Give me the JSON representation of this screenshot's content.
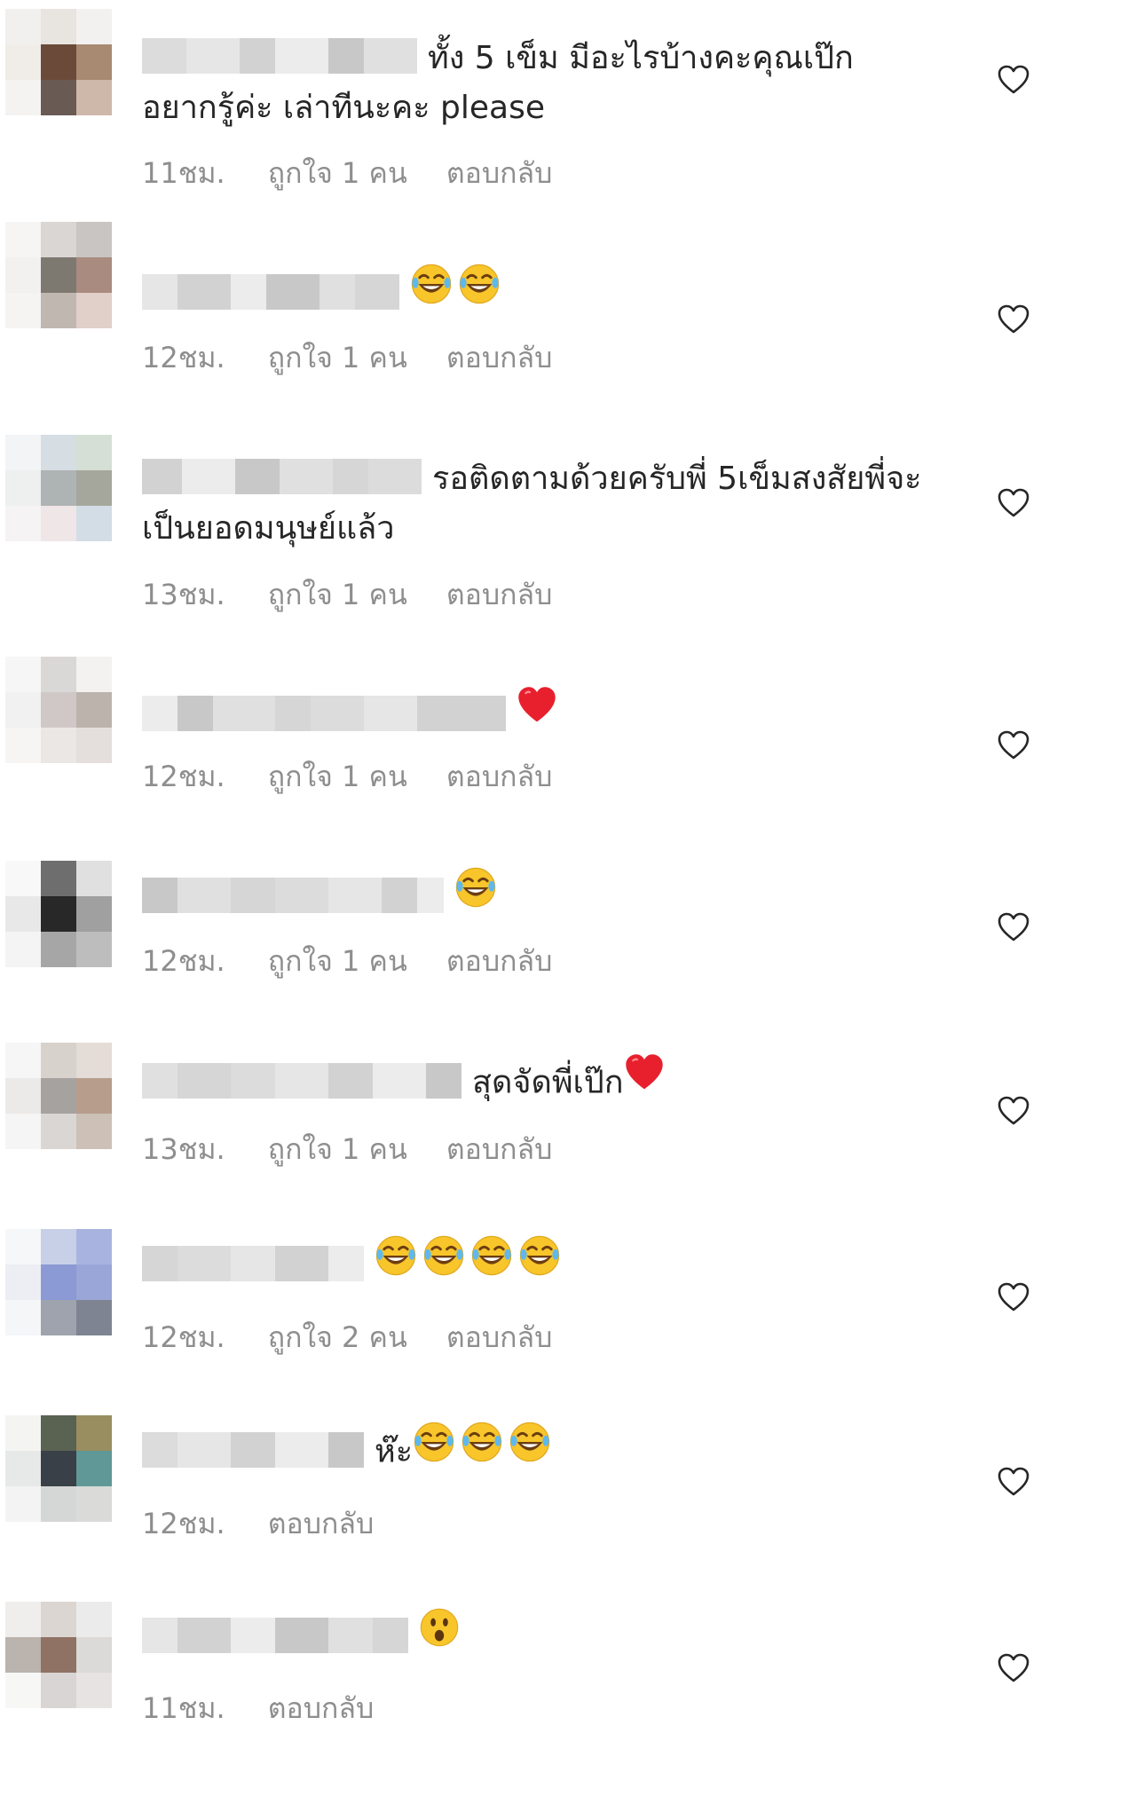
{
  "comments": [
    {
      "text_lines": [
        "ทั้ง 5 เข็ม มีอะไรบ้างคะคุณเป๊ก",
        "อยากรู้ค่ะ เล่าทีนะคะ please"
      ],
      "emojis": [],
      "time": "11ชม.",
      "likes": "ถูกใจ 1 คน",
      "reply": "ตอบกลับ"
    },
    {
      "text_lines": [
        ""
      ],
      "emojis": [
        "laugh",
        "laugh"
      ],
      "time": "12ชม.",
      "likes": "ถูกใจ 1 คน",
      "reply": "ตอบกลับ"
    },
    {
      "text_lines": [
        "รอติดตามด้วยครับพี่ 5เข็มสงสัยพี่จะ",
        "เป็นยอดมนุษย์แล้ว"
      ],
      "emojis": [],
      "time": "13ชม.",
      "likes": "ถูกใจ 1 คน",
      "reply": "ตอบกลับ"
    },
    {
      "text_lines": [
        ""
      ],
      "emojis": [
        "heart"
      ],
      "time": "12ชม.",
      "likes": "ถูกใจ 1 คน",
      "reply": "ตอบกลับ"
    },
    {
      "text_lines": [
        ""
      ],
      "emojis": [
        "laugh"
      ],
      "time": "12ชม.",
      "likes": "ถูกใจ 1 คน",
      "reply": "ตอบกลับ"
    },
    {
      "text_lines": [
        "สุดจัดพี่เป๊ก"
      ],
      "emojis": [
        "heart"
      ],
      "time": "13ชม.",
      "likes": "ถูกใจ 1 คน",
      "reply": "ตอบกลับ"
    },
    {
      "text_lines": [
        ""
      ],
      "emojis": [
        "laugh",
        "laugh",
        "laugh",
        "laugh"
      ],
      "time": "12ชม.",
      "likes": "ถูกใจ 2 คน",
      "reply": "ตอบกลับ"
    },
    {
      "text_lines": [
        "ห๊ะ"
      ],
      "emojis": [
        "laugh",
        "laugh",
        "laugh"
      ],
      "time": "12ชม.",
      "likes": "",
      "reply": "ตอบกลับ"
    },
    {
      "text_lines": [
        ""
      ],
      "emojis": [
        "surprised"
      ],
      "time": "11ชม.",
      "likes": "",
      "reply": "ตอบกลับ"
    }
  ],
  "icons": {
    "like": "heart-outline-icon",
    "laugh": "face-with-tears-of-joy",
    "heart": "red-heart",
    "surprised": "face-with-open-mouth"
  },
  "colors": {
    "meta_text": "#8e8e8e",
    "body_text": "#262626",
    "heart_red": "#e8202e",
    "emoji_yellow": "#f8c52b"
  }
}
